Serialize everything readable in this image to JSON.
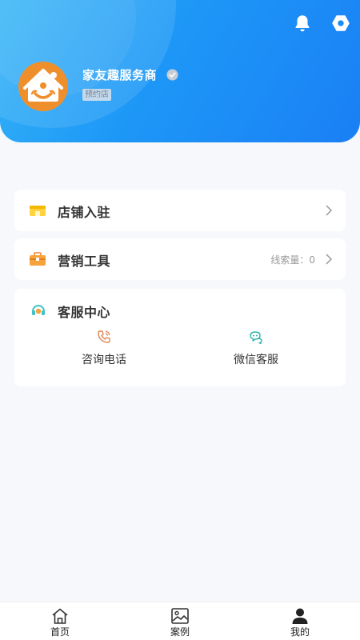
{
  "header": {
    "store_name": "家友趣服务商",
    "store_type_badge": "预约店",
    "icons": [
      "bell-icon",
      "settings-icon",
      "verified-icon"
    ]
  },
  "menu": {
    "shop_entry": {
      "label": "店铺入驻",
      "icon": "shop-icon"
    },
    "marketing": {
      "label": "营销工具",
      "extra_label": "线索量：",
      "extra_value": "0",
      "icon": "toolbox-icon"
    }
  },
  "service": {
    "title": "客服中心",
    "icon": "headset-icon",
    "items": [
      {
        "label": "咨询电话",
        "icon": "phone-icon"
      },
      {
        "label": "微信客服",
        "icon": "wechat-icon"
      }
    ]
  },
  "tabbar": {
    "tabs": [
      {
        "label": "首页",
        "icon": "home-icon"
      },
      {
        "label": "案例",
        "icon": "image-icon"
      },
      {
        "label": "我的",
        "icon": "user-icon"
      }
    ],
    "active": "我的"
  },
  "colors": {
    "brand_blue": "#1a8cf6",
    "orange": "#ef8f2c",
    "teal": "#2bb5a8"
  }
}
